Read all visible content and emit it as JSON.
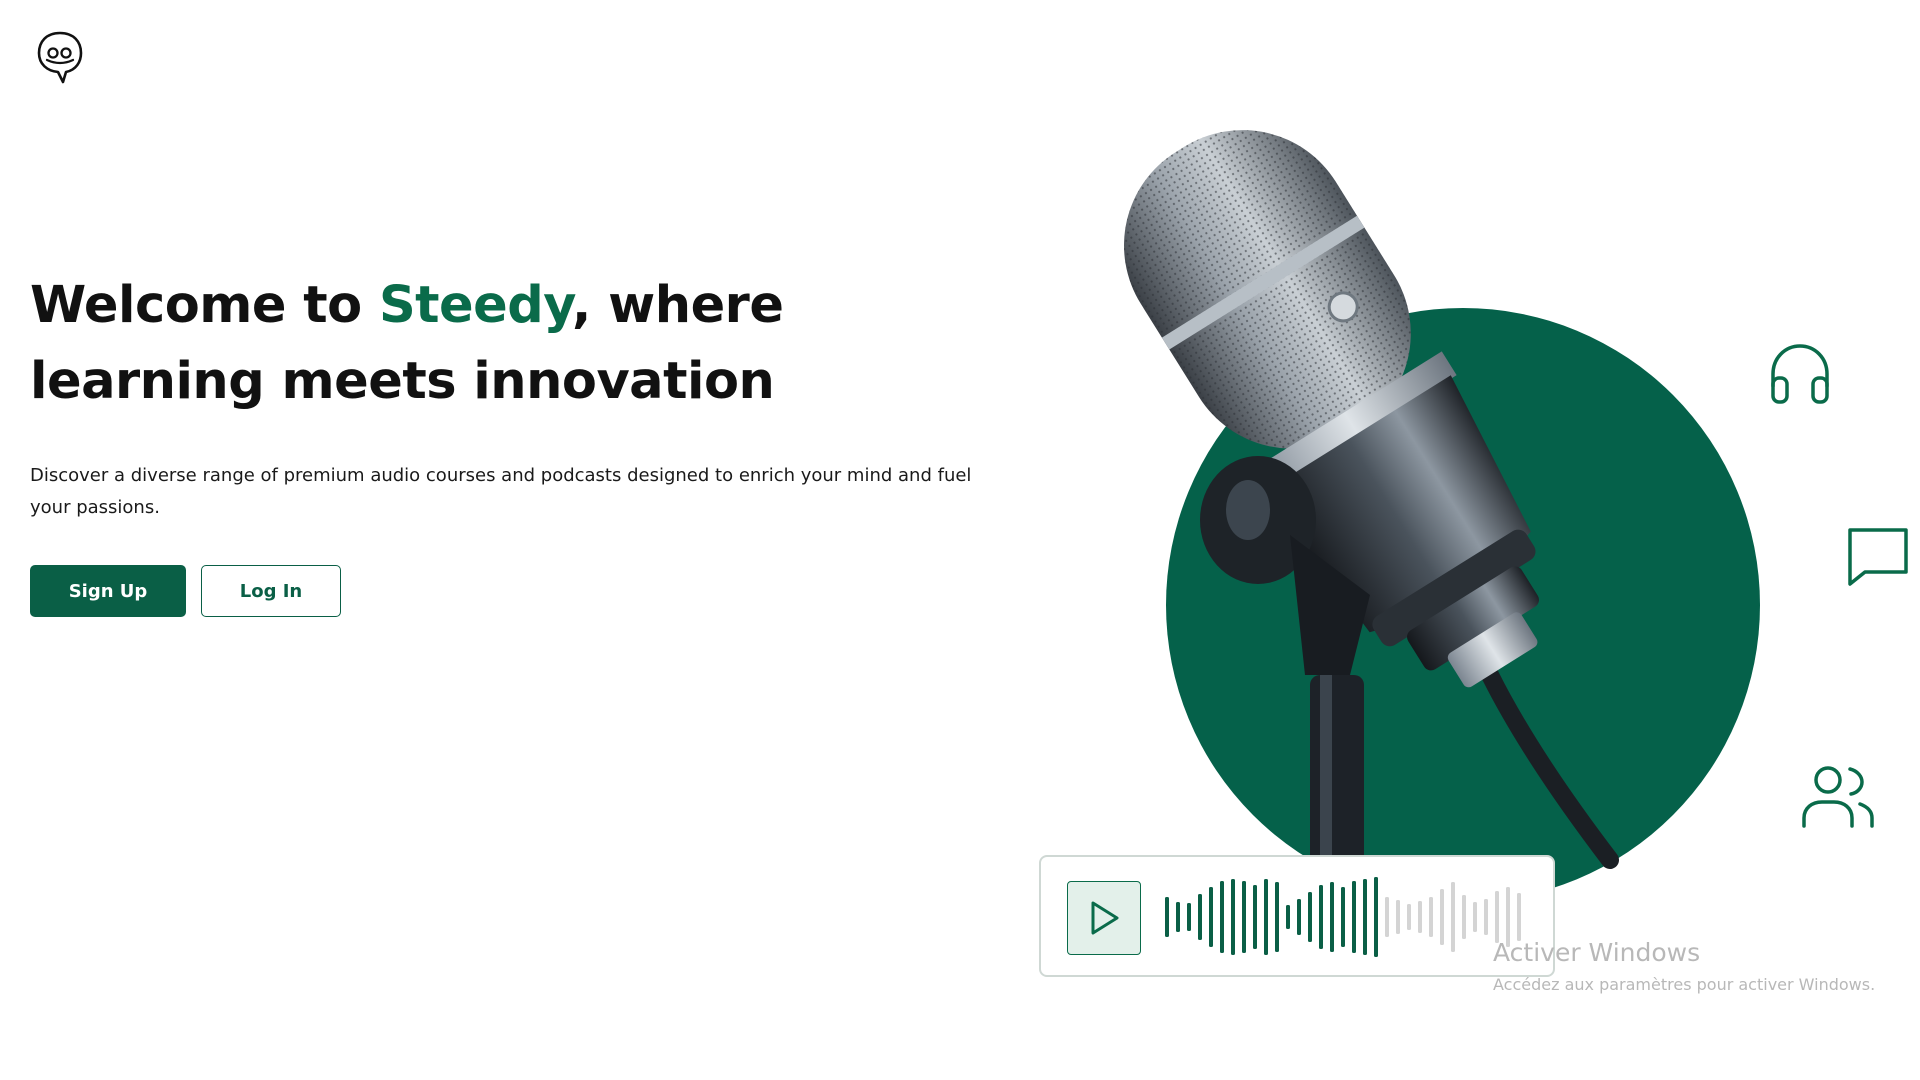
{
  "logo": {
    "icon": "speech-bubble-face-icon"
  },
  "hero": {
    "title_before": "Welcome to ",
    "brand": "Steedy",
    "title_after_line1": ", where",
    "title_line2": "learning meets innovation",
    "subtitle": "Discover a diverse range of premium audio courses and podcasts designed to enrich your mind and fuel your passions."
  },
  "buttons": {
    "signup": "Sign Up",
    "login": "Log In"
  },
  "side_icons": [
    "headphones-icon",
    "chat-icon",
    "users-icon"
  ],
  "player": {
    "play_icon": "play-icon"
  },
  "watermark": {
    "title": "Activer Windows",
    "subtitle": "Accédez aux paramètres pour activer Windows."
  },
  "colors": {
    "brand": "#0a6b4a",
    "button": "#0a5f46",
    "circle": "#05614a",
    "wave_inactive": "#d4d4d4"
  }
}
